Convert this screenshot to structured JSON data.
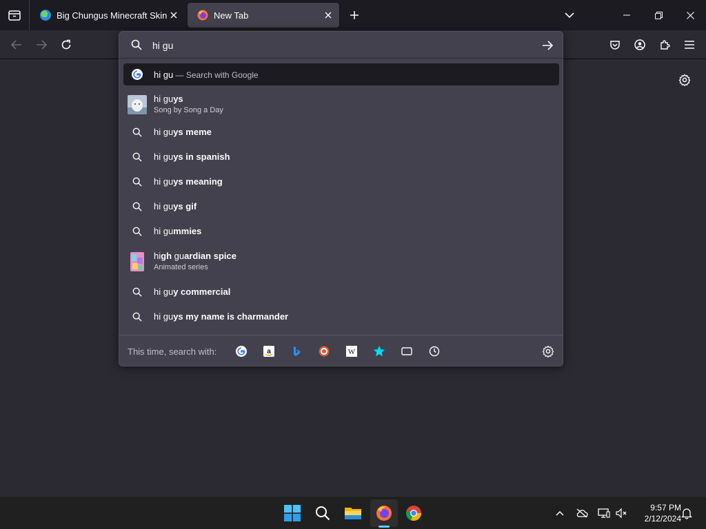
{
  "tabs": [
    {
      "title": "Big Chungus Minecraft Skin",
      "active": false
    },
    {
      "title": "New Tab",
      "active": true
    }
  ],
  "urlbar": {
    "value": "hi gu",
    "suggestions": [
      {
        "kind": "engine",
        "prefix": "hi gu",
        "bold": "",
        "suffix": "",
        "action": "Search with Google",
        "icon": "google-icon"
      },
      {
        "kind": "rich",
        "prefix": "hi gu",
        "bold": "ys",
        "subtitle": "Song by Song a Day",
        "icon": "thumbnail"
      },
      {
        "kind": "search",
        "prefix": "hi gu",
        "bold": "ys meme"
      },
      {
        "kind": "search",
        "prefix": "hi gu",
        "bold": "ys in spanish"
      },
      {
        "kind": "search",
        "prefix": "hi gu",
        "bold": "ys meaning"
      },
      {
        "kind": "search",
        "prefix": "hi gu",
        "bold": "ys gif"
      },
      {
        "kind": "search",
        "prefix": "hi gu",
        "bold": "mmies"
      },
      {
        "kind": "rich",
        "prefix": "hi",
        "bold": "gh",
        "mid": " gu",
        "bold2": "ardian spice",
        "subtitle": "Animated series",
        "icon": "thumbnail"
      },
      {
        "kind": "search",
        "prefix": "hi gu",
        "bold": "y commercial"
      },
      {
        "kind": "search",
        "prefix": "hi gu",
        "bold": "ys my name is charmander"
      }
    ],
    "oneoff_label": "This time, search with:",
    "engines": [
      "google-icon",
      "amazon-icon",
      "bing-icon",
      "duckduckgo-icon",
      "wikipedia-icon",
      "bookmarks-star-icon",
      "tabs-icon",
      "history-clock-icon"
    ]
  },
  "clock": {
    "time": "9:57 PM",
    "date": "2/12/2024"
  },
  "colors": {
    "accent": "#60cdff",
    "popup_bg": "#42414d",
    "page_bg": "#2b2a33",
    "tabstrip_bg": "#1c1b22"
  }
}
